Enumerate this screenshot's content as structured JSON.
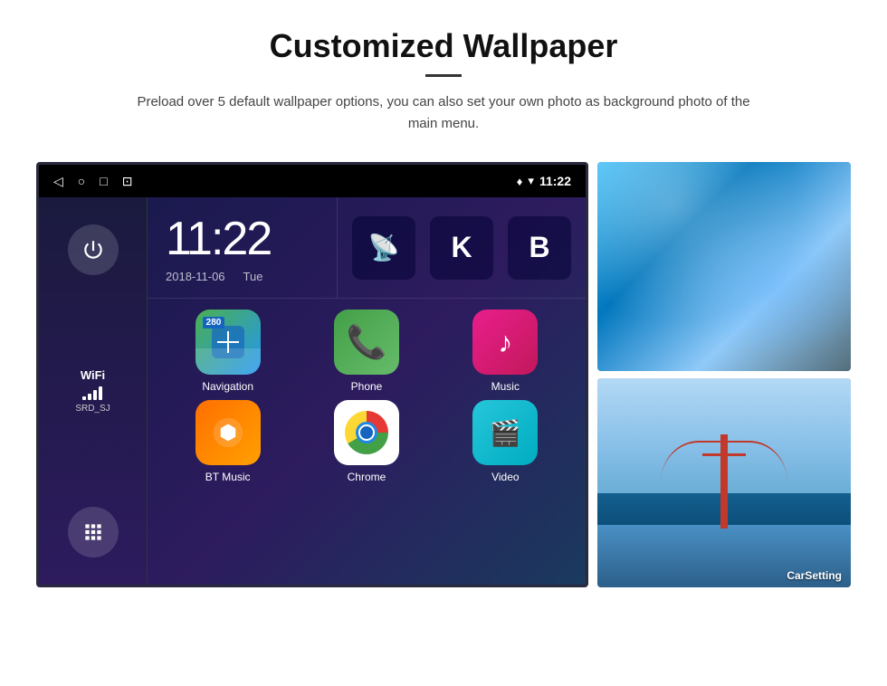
{
  "header": {
    "title": "Customized Wallpaper",
    "description": "Preload over 5 default wallpaper options, you can also set your own photo as background photo of the main menu."
  },
  "statusBar": {
    "time": "11:22",
    "locationIcon": "♦",
    "wifiIcon": "▾"
  },
  "clockWidget": {
    "time": "11:22",
    "date": "2018-11-06",
    "day": "Tue"
  },
  "sidebar": {
    "wifiLabel": "WiFi",
    "wifiSSID": "SRD_SJ"
  },
  "apps": [
    {
      "name": "Navigation",
      "label": "Navigation",
      "badge": "280"
    },
    {
      "name": "Phone",
      "label": "Phone"
    },
    {
      "name": "Music",
      "label": "Music"
    },
    {
      "name": "BT Music",
      "label": "BT Music"
    },
    {
      "name": "Chrome",
      "label": "Chrome"
    },
    {
      "name": "Video",
      "label": "Video"
    }
  ],
  "wallpapers": {
    "carSettingLabel": "CarSetting"
  }
}
